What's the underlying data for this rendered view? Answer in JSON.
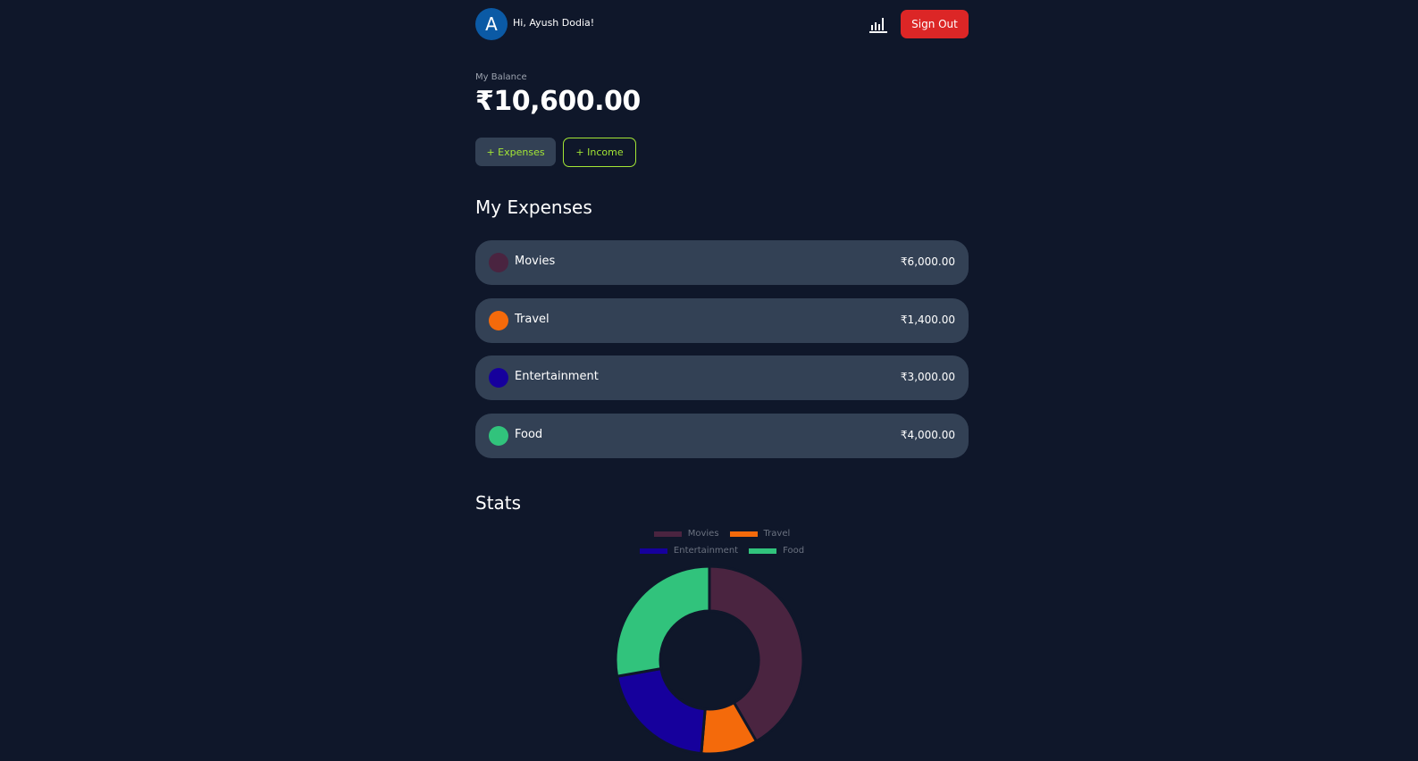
{
  "header": {
    "avatar_letter": "A",
    "greeting": "Hi, Ayush Dodia!",
    "stats_icon": "bar-chart-icon",
    "signout_label": "Sign Out"
  },
  "balance": {
    "label": "My Balance",
    "amount": "₹10,600.00"
  },
  "actions": {
    "expenses_label": "+ Expenses",
    "income_label": "+ Income"
  },
  "expenses": {
    "title": "My Expenses",
    "items": [
      {
        "name": "Movies",
        "amount": "₹6,000.00",
        "color": "#4a2440"
      },
      {
        "name": "Travel",
        "amount": "₹1,400.00",
        "color": "#f46a0b"
      },
      {
        "name": "Entertainment",
        "amount": "₹3,000.00",
        "color": "#16009c"
      },
      {
        "name": "Food",
        "amount": "₹4,000.00",
        "color": "#31c37c"
      }
    ]
  },
  "stats": {
    "title": "Stats"
  },
  "chart_data": {
    "type": "pie",
    "subtype": "doughnut",
    "legend_position": "top",
    "categories": [
      "Movies",
      "Travel",
      "Entertainment",
      "Food"
    ],
    "values": [
      6000,
      1400,
      3000,
      4000
    ],
    "colors": [
      "#4a2440",
      "#f46a0b",
      "#16009c",
      "#31c37c"
    ]
  }
}
